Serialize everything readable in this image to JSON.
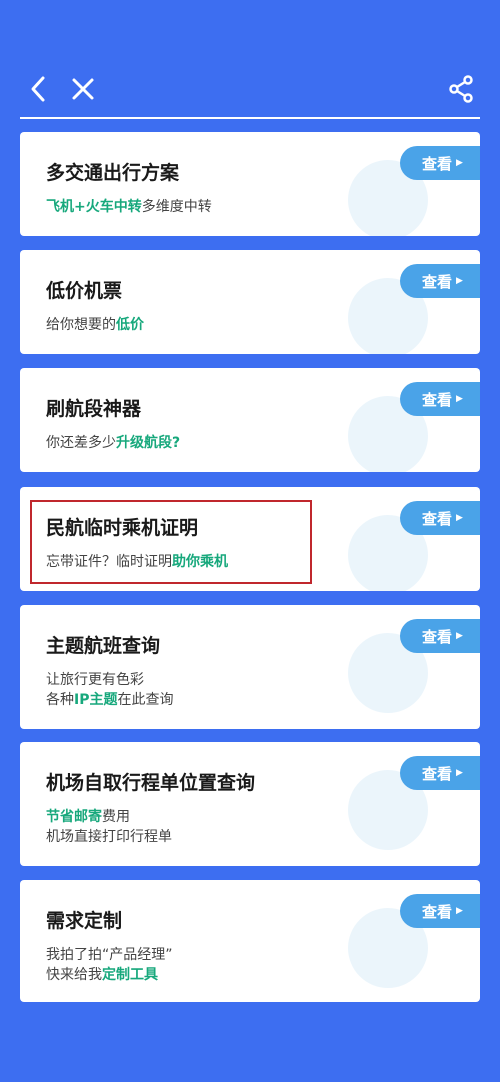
{
  "topbar": {
    "back_icon": "chevron-left-icon",
    "close_icon": "close-icon",
    "share_icon": "share-icon"
  },
  "colors": {
    "background": "#3d6ef1",
    "accent_green": "#17a87c",
    "button_blue": "#4aa3e8",
    "highlight_red": "#c0272d"
  },
  "cards": [
    {
      "title": "多交通出行方案",
      "view_label": "查看",
      "lines": [
        [
          {
            "t": "飞机+火车中转",
            "hl": true
          },
          {
            "t": "多维度中转",
            "hl": false
          }
        ]
      ]
    },
    {
      "title": "低价机票",
      "view_label": "查看",
      "lines": [
        [
          {
            "t": "给你想要的",
            "hl": false
          },
          {
            "t": "低价",
            "hl": true
          }
        ]
      ]
    },
    {
      "title": "刷航段神器",
      "view_label": "查看",
      "lines": [
        [
          {
            "t": "你还差多少",
            "hl": false
          },
          {
            "t": "升级航段?",
            "hl": true
          }
        ]
      ]
    },
    {
      "title": "民航临时乘机证明",
      "view_label": "查看",
      "lines": [
        [
          {
            "t": "忘带证件？临时证明",
            "hl": false
          },
          {
            "t": "助你乘机",
            "hl": true
          }
        ]
      ]
    },
    {
      "title": "主题航班查询",
      "view_label": "查看",
      "lines": [
        [
          {
            "t": "让旅行更有色彩",
            "hl": false
          }
        ],
        [
          {
            "t": "各种",
            "hl": false
          },
          {
            "t": "IP主题",
            "hl": true
          },
          {
            "t": "在此查询",
            "hl": false
          }
        ]
      ]
    },
    {
      "title": "机场自取行程单位置查询",
      "view_label": "查看",
      "lines": [
        [
          {
            "t": "节省邮寄",
            "hl": true
          },
          {
            "t": "费用",
            "hl": false
          }
        ],
        [
          {
            "t": "机场直接打印行程单",
            "hl": false
          }
        ]
      ]
    },
    {
      "title": "需求定制",
      "view_label": "查看",
      "lines": [
        [
          {
            "t": "我拍了拍“产品经理”",
            "hl": false
          }
        ],
        [
          {
            "t": "快来给我",
            "hl": false
          },
          {
            "t": "定制工具",
            "hl": true
          }
        ]
      ]
    }
  ]
}
